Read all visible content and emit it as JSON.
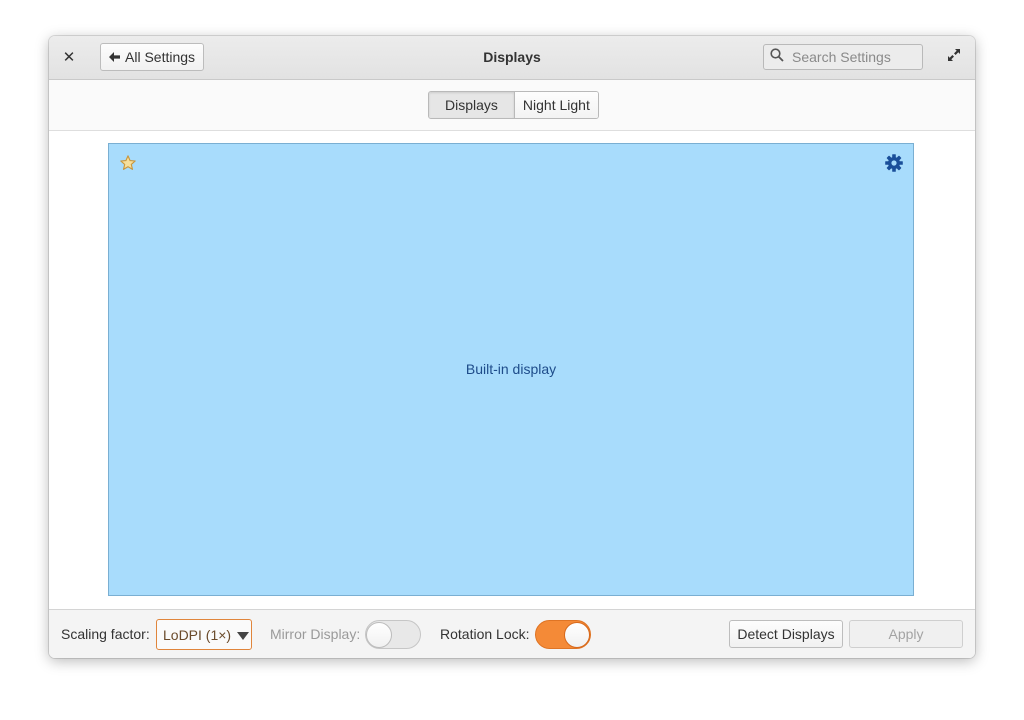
{
  "window": {
    "title": "Displays"
  },
  "header": {
    "back_label": "All Settings",
    "search_placeholder": "Search Settings"
  },
  "tabs": [
    {
      "label": "Displays",
      "active": true
    },
    {
      "label": "Night Light",
      "active": false
    }
  ],
  "display": {
    "name": "Built-in display",
    "is_primary": true,
    "color": "#a8dcfc"
  },
  "footer": {
    "scaling_label": "Scaling factor:",
    "scaling_value": "LoDPI (1×)",
    "mirror_label": "Mirror Display:",
    "mirror_enabled": false,
    "rotation_label": "Rotation Lock:",
    "rotation_enabled": true,
    "detect_label": "Detect Displays",
    "apply_label": "Apply"
  },
  "colors": {
    "accent": "#f48a37",
    "display_tile": "#a8dcfc",
    "display_text": "#1e4c8a",
    "star": "#d4a84a"
  },
  "icons": [
    "close-icon",
    "arrow-left-icon",
    "search-icon",
    "maximize-icon",
    "star-icon",
    "gear-icon",
    "dropdown-arrow-icon"
  ]
}
